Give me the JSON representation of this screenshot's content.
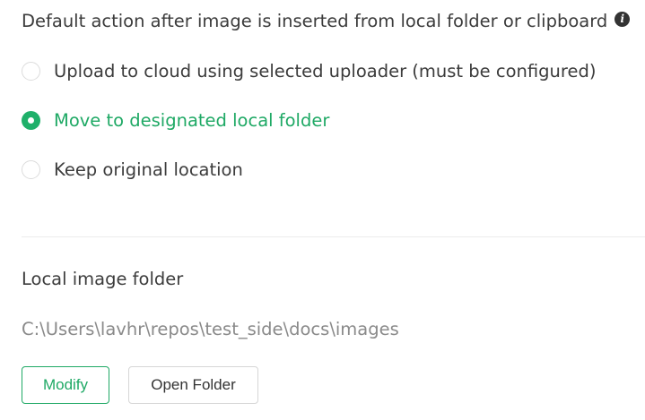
{
  "image_insert": {
    "title": "Default action after image is inserted from local folder or clipboard",
    "info_icon": "info-icon",
    "options": [
      {
        "label": "Upload to cloud using selected uploader (must be configured)",
        "selected": false
      },
      {
        "label": "Move to designated local folder",
        "selected": true
      },
      {
        "label": "Keep original location",
        "selected": false
      }
    ],
    "accent_color": "#1fb06a"
  },
  "local_folder": {
    "title": "Local image folder",
    "path": "C:\\Users\\lavhr\\repos\\test_side\\docs\\images",
    "modify_label": "Modify",
    "open_folder_label": "Open Folder"
  }
}
